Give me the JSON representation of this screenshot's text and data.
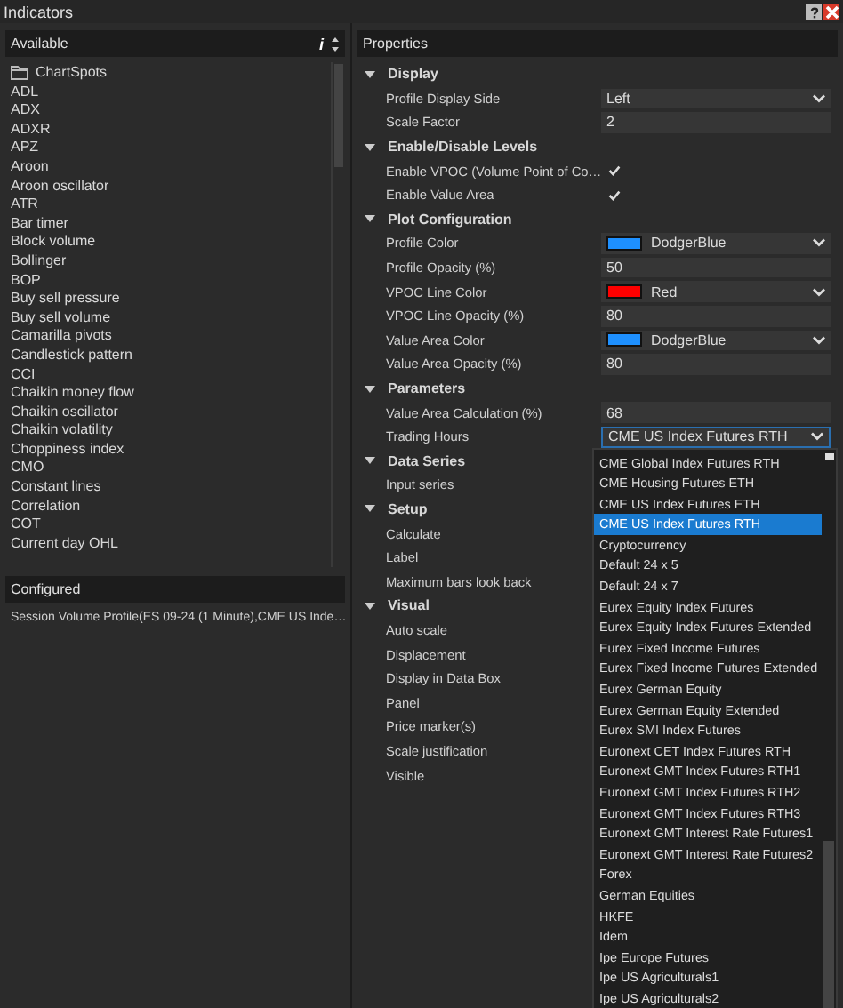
{
  "window": {
    "title": "Indicators"
  },
  "available": {
    "header": "Available",
    "info": "i",
    "items": [
      {
        "label": "ChartSpots",
        "kind": "folder"
      },
      {
        "label": "ADL"
      },
      {
        "label": "ADX"
      },
      {
        "label": "ADXR"
      },
      {
        "label": "APZ"
      },
      {
        "label": "Aroon"
      },
      {
        "label": "Aroon oscillator"
      },
      {
        "label": "ATR"
      },
      {
        "label": "Bar timer"
      },
      {
        "label": "Block volume"
      },
      {
        "label": "Bollinger"
      },
      {
        "label": "BOP"
      },
      {
        "label": "Buy sell pressure"
      },
      {
        "label": "Buy sell volume"
      },
      {
        "label": "Camarilla pivots"
      },
      {
        "label": "Candlestick pattern"
      },
      {
        "label": "CCI"
      },
      {
        "label": "Chaikin money flow"
      },
      {
        "label": "Chaikin oscillator"
      },
      {
        "label": "Chaikin volatility"
      },
      {
        "label": "Choppiness index"
      },
      {
        "label": "CMO"
      },
      {
        "label": "Constant lines"
      },
      {
        "label": "Correlation"
      },
      {
        "label": "COT"
      },
      {
        "label": "Current day OHL"
      }
    ]
  },
  "configured": {
    "header": "Configured",
    "items": [
      "Session Volume Profile(ES 09-24 (1 Minute),CME US Inde…"
    ]
  },
  "properties": {
    "header": "Properties",
    "categories": [
      {
        "name": "Display",
        "expanded": true,
        "rows": [
          {
            "label": "Profile Display Side",
            "kind": "dropdown",
            "value": "Left"
          },
          {
            "label": "Scale Factor",
            "kind": "text",
            "value": "2"
          }
        ]
      },
      {
        "name": "Enable/Disable Levels",
        "expanded": true,
        "rows": [
          {
            "label": "Enable VPOC (Volume Point of Co…",
            "kind": "checkbox",
            "checked": true
          },
          {
            "label": "Enable Value Area",
            "kind": "checkbox",
            "checked": true
          }
        ]
      },
      {
        "name": "Plot Configuration",
        "expanded": true,
        "rows": [
          {
            "label": "Profile Color",
            "kind": "color",
            "value": "DodgerBlue",
            "color": "#1e90ff"
          },
          {
            "label": "Profile Opacity (%)",
            "kind": "text",
            "value": "50"
          },
          {
            "label": "VPOC Line Color",
            "kind": "color",
            "value": "Red",
            "color": "#ff0000"
          },
          {
            "label": "VPOC Line Opacity (%)",
            "kind": "text",
            "value": "80"
          },
          {
            "label": "Value Area Color",
            "kind": "color",
            "value": "DodgerBlue",
            "color": "#1e90ff"
          },
          {
            "label": "Value Area Opacity (%)",
            "kind": "text",
            "value": "80"
          }
        ]
      },
      {
        "name": "Parameters",
        "expanded": true,
        "rows": [
          {
            "label": "Value Area Calculation (%)",
            "kind": "text",
            "value": "68"
          },
          {
            "label": "Trading Hours",
            "kind": "dropdown",
            "value": "CME US Index Futures RTH",
            "open": true
          }
        ]
      },
      {
        "name": "Data Series",
        "expanded": true,
        "rows": [
          {
            "label": "Input series",
            "kind": "hidden"
          }
        ]
      },
      {
        "name": "Setup",
        "expanded": true,
        "rows": [
          {
            "label": "Calculate",
            "kind": "hidden"
          },
          {
            "label": "Label",
            "kind": "hidden"
          },
          {
            "label": "Maximum bars look back",
            "kind": "hidden"
          }
        ]
      },
      {
        "name": "Visual",
        "expanded": true,
        "rows": [
          {
            "label": "Auto scale",
            "kind": "hidden"
          },
          {
            "label": "Displacement",
            "kind": "hidden"
          },
          {
            "label": "Display in Data Box",
            "kind": "hidden"
          },
          {
            "label": "Panel",
            "kind": "hidden"
          },
          {
            "label": "Price marker(s)",
            "kind": "hidden"
          },
          {
            "label": "Scale justification",
            "kind": "hidden"
          },
          {
            "label": "Visible",
            "kind": "hidden"
          }
        ]
      }
    ]
  },
  "dropdown_options": [
    {
      "label": "CME Global Index Futures RTH",
      "selected": false
    },
    {
      "label": "CME Housing Futures ETH",
      "selected": false
    },
    {
      "label": "CME US Index Futures ETH",
      "selected": false
    },
    {
      "label": "CME US Index Futures RTH",
      "selected": true
    },
    {
      "label": "Cryptocurrency",
      "selected": false
    },
    {
      "label": "Default 24 x 5",
      "selected": false
    },
    {
      "label": "Default 24 x 7",
      "selected": false
    },
    {
      "label": "Eurex Equity Index Futures",
      "selected": false
    },
    {
      "label": "Eurex Equity Index Futures Extended",
      "selected": false
    },
    {
      "label": "Eurex Fixed Income Futures",
      "selected": false
    },
    {
      "label": "Eurex Fixed Income Futures Extended",
      "selected": false
    },
    {
      "label": "Eurex German Equity",
      "selected": false
    },
    {
      "label": "Eurex German Equity Extended",
      "selected": false
    },
    {
      "label": "Eurex SMI Index Futures",
      "selected": false
    },
    {
      "label": "Euronext CET Index Futures RTH",
      "selected": false
    },
    {
      "label": "Euronext GMT Index Futures RTH1",
      "selected": false
    },
    {
      "label": "Euronext GMT Index Futures RTH2",
      "selected": false
    },
    {
      "label": "Euronext GMT Index Futures RTH3",
      "selected": false
    },
    {
      "label": "Euronext GMT Interest Rate Futures1",
      "selected": false
    },
    {
      "label": "Euronext GMT Interest Rate Futures2",
      "selected": false
    },
    {
      "label": "Forex",
      "selected": false
    },
    {
      "label": "German Equities",
      "selected": false
    },
    {
      "label": "HKFE",
      "selected": false
    },
    {
      "label": "Idem",
      "selected": false
    },
    {
      "label": "Ipe Europe Futures",
      "selected": false
    },
    {
      "label": "Ipe US Agriculturals1",
      "selected": false
    },
    {
      "label": "Ipe US Agriculturals2",
      "selected": false
    }
  ]
}
